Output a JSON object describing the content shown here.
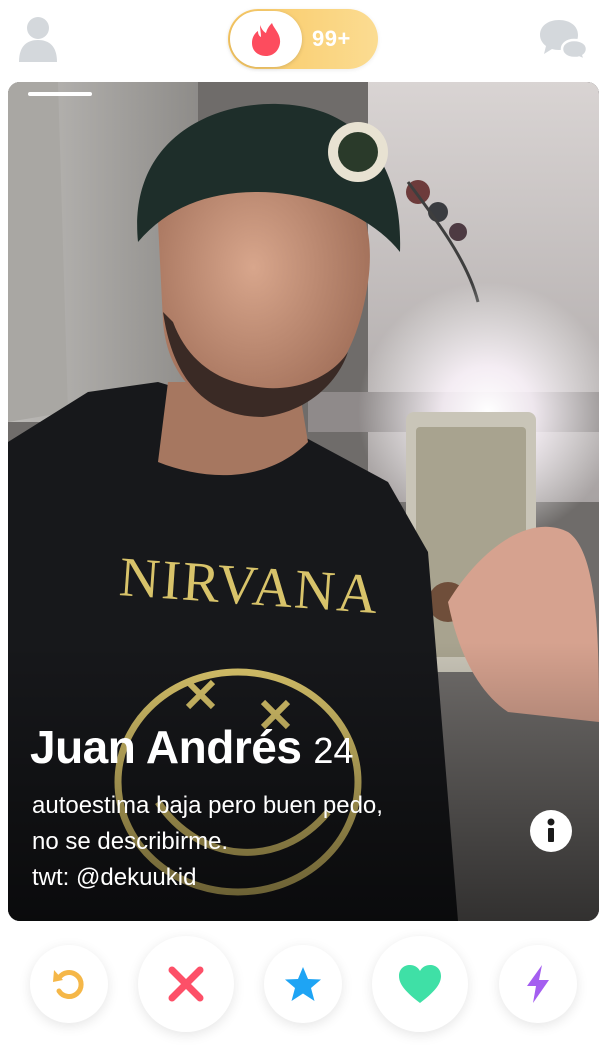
{
  "header": {
    "likes_badge": "99+"
  },
  "card": {
    "name": "Juan Andrés",
    "age": "24",
    "bio_lines": [
      "autoestima baja pero buen pedo,",
      "no se describirme.",
      "twt: @dekuukid"
    ]
  },
  "colors": {
    "brand": "#fd4c5e",
    "gold": "#f9c862",
    "rewind": "#f5b748",
    "nope": "#fd5068",
    "super_like": "#1ea4f4",
    "like": "#3fe0a6",
    "boost": "#a45ef0"
  },
  "icons": {
    "profile": "person-icon",
    "flame": "flame-icon",
    "chat": "chat-bubbles-icon",
    "info": "info-icon",
    "rewind": "rewind-icon",
    "nope": "x-icon",
    "super_like": "star-icon",
    "like": "heart-icon",
    "boost": "lightning-icon"
  }
}
